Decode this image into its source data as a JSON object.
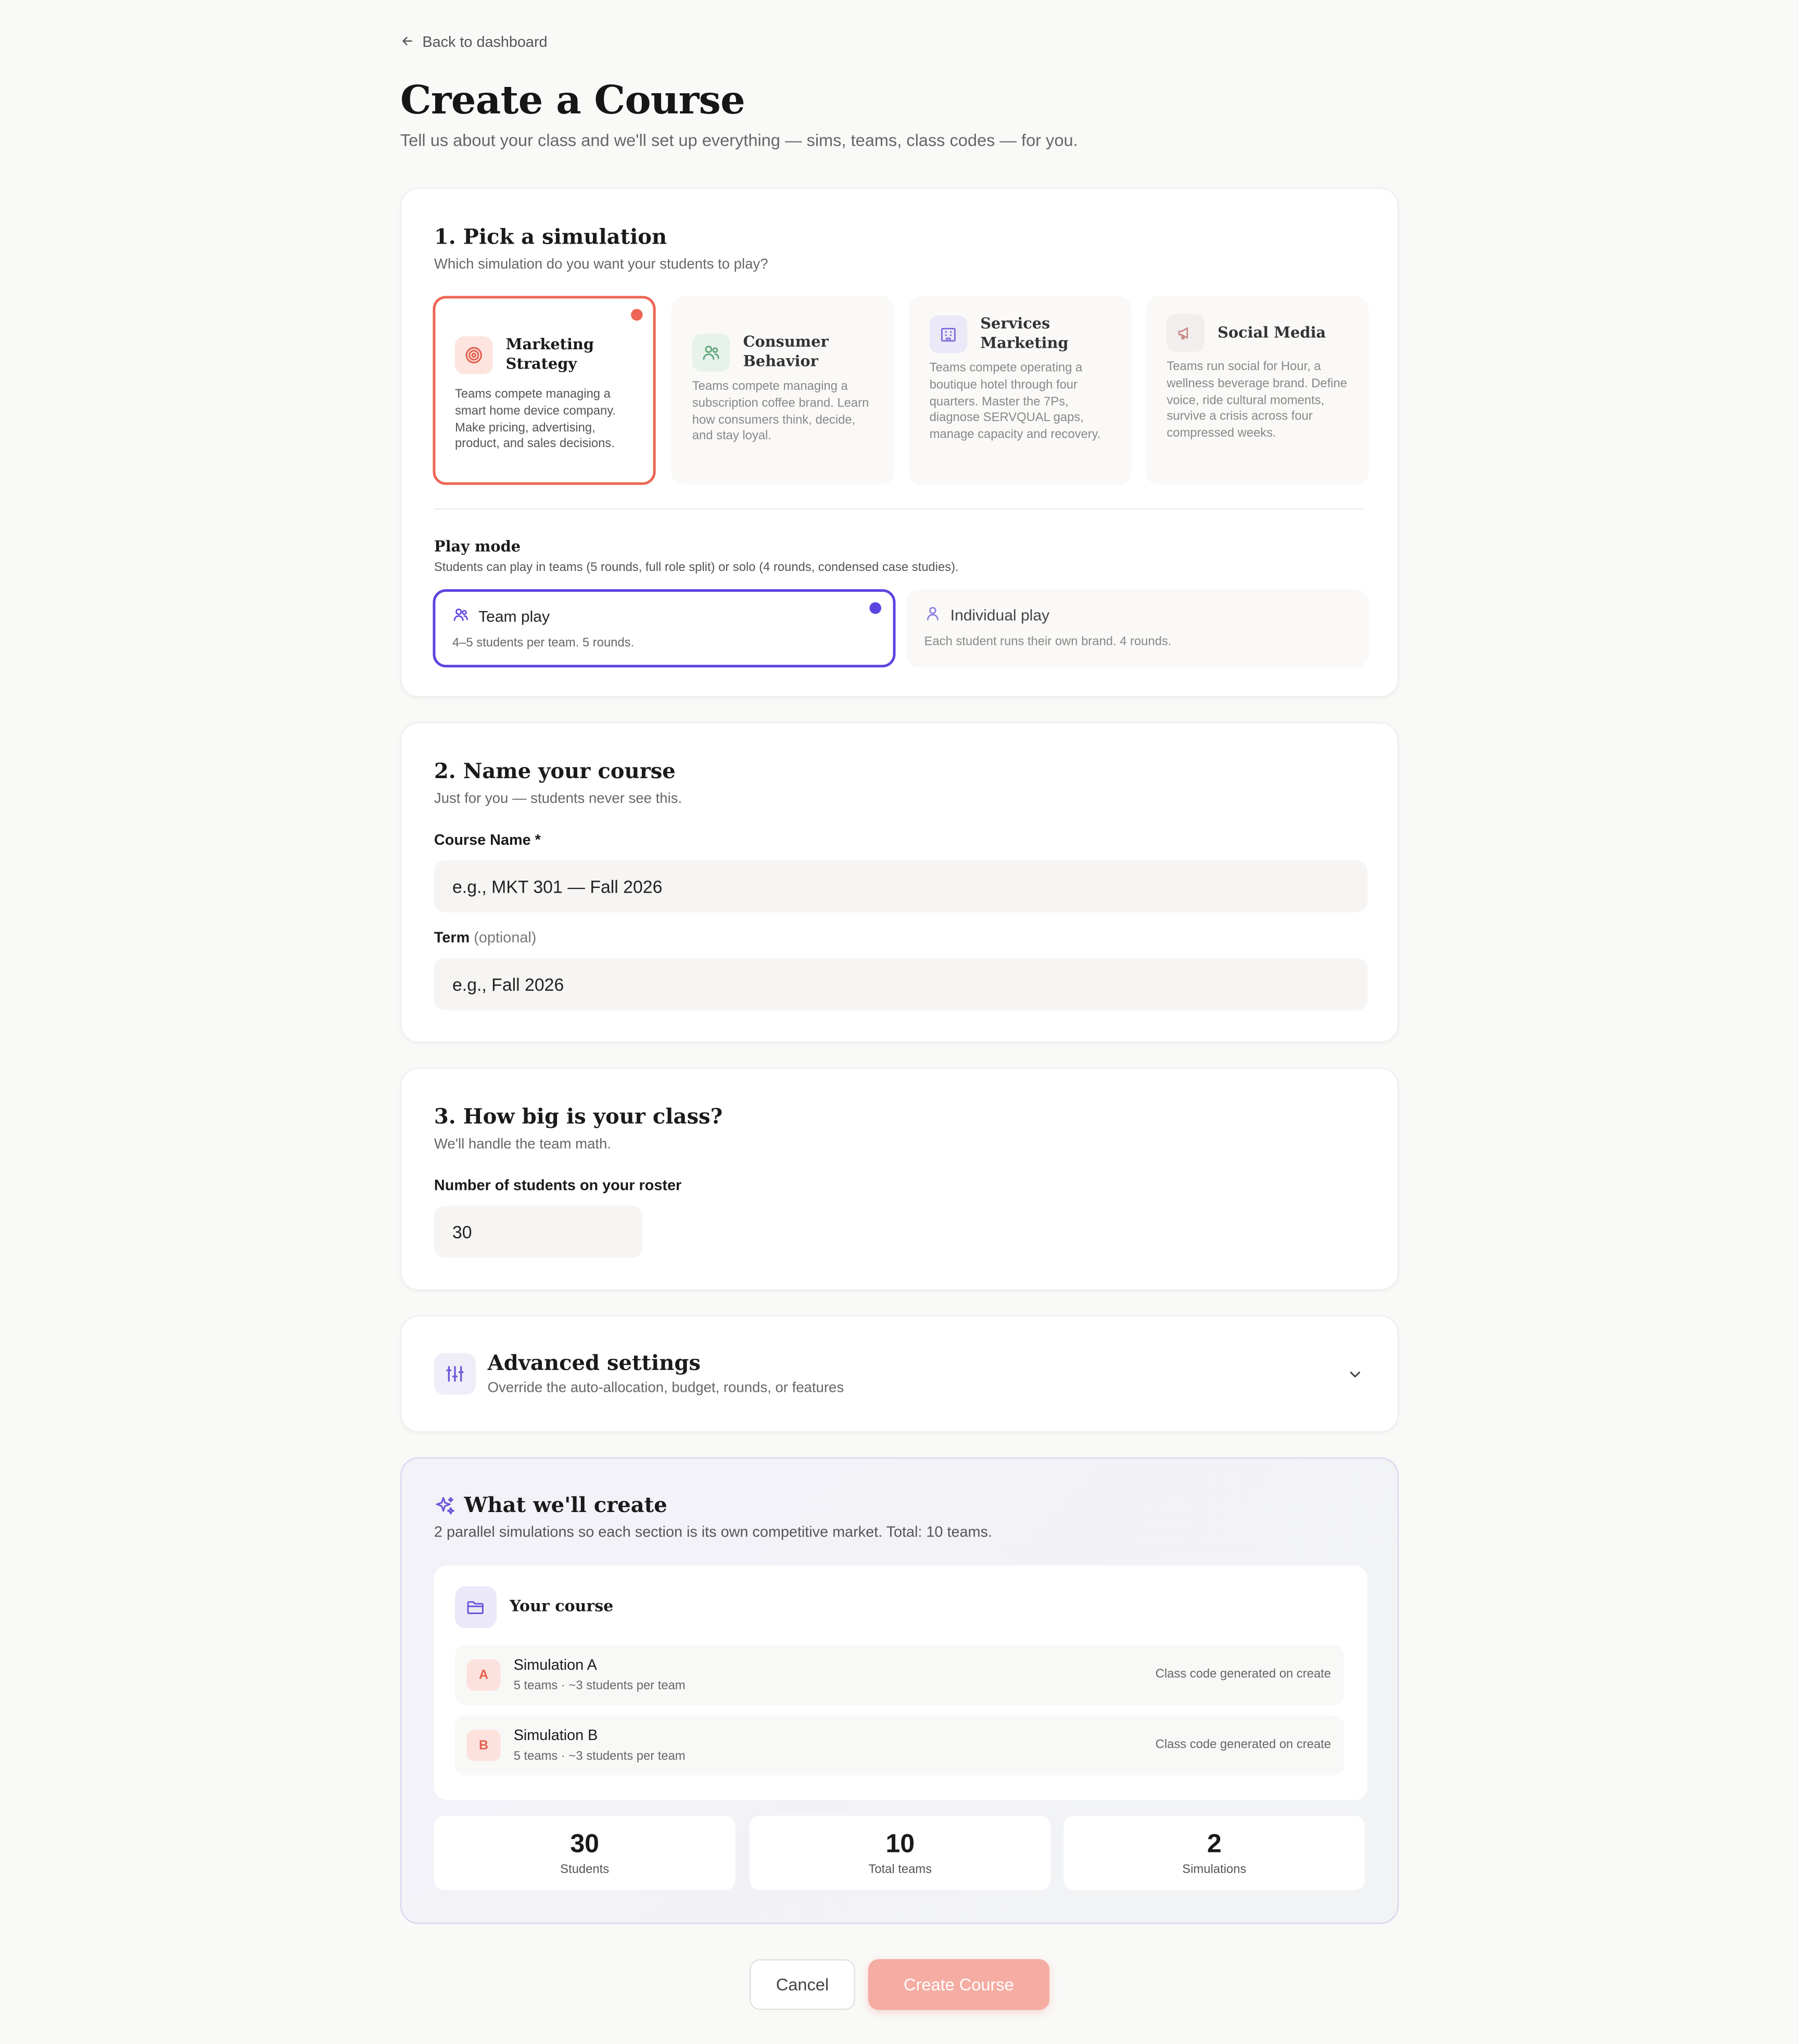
{
  "nav": {
    "back_label": "Back to dashboard"
  },
  "header": {
    "title": "Create a Course",
    "subtitle": "Tell us about your class and we'll set up everything — sims, teams, class codes — for you."
  },
  "simulation_section": {
    "title": "1. Pick a simulation",
    "subtitle": "Which simulation do you want your students to play?",
    "options": [
      {
        "name": "Marketing Strategy",
        "description": "Teams compete managing a smart home device company. Make pricing, advertising, product, and sales decisions.",
        "icon": "target-icon",
        "selected": true
      },
      {
        "name": "Consumer Behavior",
        "description": "Teams compete managing a subscription coffee brand. Learn how consumers think, decide, and stay loyal.",
        "icon": "users-icon",
        "selected": false
      },
      {
        "name": "Services Marketing",
        "description": "Teams compete operating a boutique hotel through four quarters. Master the 7Ps, diagnose SERVQUAL gaps, manage capacity and recovery.",
        "icon": "building-icon",
        "selected": false
      },
      {
        "name": "Social Media",
        "description": "Teams run social for Hour, a wellness beverage brand. Define voice, ride cultural moments, survive a crisis across four compressed weeks.",
        "icon": "megaphone-icon",
        "selected": false
      }
    ],
    "play_mode": {
      "title": "Play mode",
      "subtitle": "Students can play in teams (5 rounds, full role split) or solo (4 rounds, condensed case studies).",
      "options": [
        {
          "label": "Team play",
          "description": "4–5 students per team. 5 rounds.",
          "icon": "users-icon",
          "selected": true
        },
        {
          "label": "Individual play",
          "description": "Each student runs their own brand. 4 rounds.",
          "icon": "user-icon",
          "selected": false
        }
      ]
    }
  },
  "name_section": {
    "title": "2. Name your course",
    "subtitle": "Just for you — students never see this.",
    "course_name_label": "Course Name *",
    "course_name_placeholder": "e.g., MKT 301 — Fall 2026",
    "course_name_value": "",
    "term_label": "Term",
    "term_optional": "(optional)",
    "term_placeholder": "e.g., Fall 2026",
    "term_value": ""
  },
  "size_section": {
    "title": "3. How big is your class?",
    "subtitle": "We'll handle the team math.",
    "students_label": "Number of students on your roster",
    "students_value": "30"
  },
  "advanced": {
    "title": "Advanced settings",
    "subtitle": "Override the auto-allocation, budget, rounds, or features",
    "icon": "sliders-icon",
    "expanded": false
  },
  "summary": {
    "title": "What we'll create",
    "subtitle": "2 parallel simulations so each section is its own competitive market. Total: 10 teams.",
    "course_label": "Your course",
    "simulations": [
      {
        "letter": "A",
        "name": "Simulation A",
        "detail": "5 teams · ~3 students per team",
        "code_note": "Class code generated on create"
      },
      {
        "letter": "B",
        "name": "Simulation B",
        "detail": "5 teams · ~3 students per team",
        "code_note": "Class code generated on create"
      }
    ],
    "stats": [
      {
        "value": "30",
        "label": "Students"
      },
      {
        "value": "10",
        "label": "Total teams"
      },
      {
        "value": "2",
        "label": "Simulations"
      }
    ]
  },
  "actions": {
    "cancel_label": "Cancel",
    "create_label": "Create Course"
  },
  "colors": {
    "accent": "#ee6655",
    "mode_accent": "#5b45e0",
    "create_button": "#f5aca2",
    "page_bg": "#f9f9f8"
  }
}
